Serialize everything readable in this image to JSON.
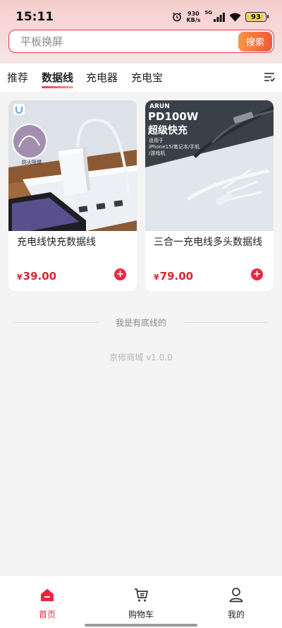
{
  "status": {
    "time": "15:11",
    "net_speed_value": "930",
    "net_speed_unit": "KB/s",
    "network_type": "5G",
    "battery": "93",
    "battery_fraction": 0.93,
    "icons": [
      "alarm-icon",
      "signal-icon",
      "wifi-icon",
      "battery-icon"
    ]
  },
  "search": {
    "placeholder": "平板换屏",
    "button_label": "搜索"
  },
  "tabs": [
    {
      "label": "推荐",
      "active": false
    },
    {
      "label": "数据线",
      "active": true
    },
    {
      "label": "充电器",
      "active": false
    },
    {
      "label": "充电宝",
      "active": false
    }
  ],
  "products": [
    {
      "title": "充电线快充数据线",
      "currency": "¥",
      "price": "39.00",
      "image": {
        "badge": "防火阻燃"
      }
    },
    {
      "title": "三合一充电线多头数据线",
      "currency": "¥",
      "price": "79.00",
      "image": {
        "brand": "ARUN",
        "headline1": "PD100W",
        "headline2": "超级快充",
        "note1": "适用于",
        "note2": "iPhone15/笔记本/手机",
        "note3": "/游戏机"
      }
    }
  ],
  "footer": {
    "end_text": "我是有底线的",
    "version": "京修商城 v1.0.0"
  },
  "nav": [
    {
      "label": "首页",
      "active": true,
      "icon": "home-icon"
    },
    {
      "label": "购物车",
      "active": false,
      "icon": "cart-icon"
    },
    {
      "label": "我的",
      "active": false,
      "icon": "user-icon"
    }
  ],
  "colors": {
    "accent": "#e8273e",
    "price": "#d7262f",
    "search_button_start": "#f79743",
    "search_button_end": "#f0573d"
  }
}
